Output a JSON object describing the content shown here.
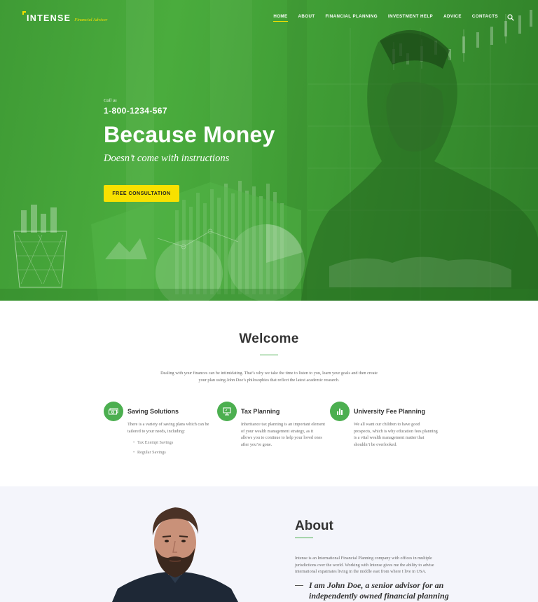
{
  "brand": {
    "name": "INTENSE",
    "tagline": "Financial Advisor",
    "accent": "#f5e000"
  },
  "nav": {
    "items": [
      "HOME",
      "ABOUT",
      "FINANCIAL PLANNING",
      "INVESTMENT HELP",
      "ADVICE",
      "CONTACTS"
    ],
    "active": "HOME",
    "search_icon": "search-icon"
  },
  "hero": {
    "call_label": "Call us",
    "phone": "1-800-1234-567",
    "title": "Because Money",
    "subtitle": "Doesn’t come with instructions",
    "cta": "FREE CONSULTATION",
    "overlay_color": "#43a33a",
    "cta_color": "#f8e100"
  },
  "welcome": {
    "title": "Welcome",
    "text": "Dealing with your finances can be intimidating. That’s why we take the time to listen to you, learn your goals and then create your plan using John Doe’s philosophies that reflect the latest academic research.",
    "features": [
      {
        "icon": "money-icon",
        "title": "Saving Solutions",
        "text": "There is a variety of saving plans which can be tailored to your needs, including:",
        "list": [
          "Tax Exempt Savings",
          "Regular Savings"
        ]
      },
      {
        "icon": "presentation-icon",
        "title": "Tax Planning",
        "text": "Inheritance tax planning is an important element of your wealth management strategy, as it allows you to continue to help your loved ones after you’re gone.",
        "list": []
      },
      {
        "icon": "bar-chart-icon",
        "title": "University Fee Planning",
        "text": "We all want our children to have good prospects, which is why education fees planning is a vital wealth management matter that shouldn’t be overlooked.",
        "list": []
      }
    ],
    "accent": "#4caf50"
  },
  "about": {
    "title": "About",
    "text": "Intense is an International Financial Planning company with offices in multiple jurisdictions over the world. Working with Intense gives me the ability to advise international expatriates living in the middle east from where I live in USA.",
    "quote": "I am John Doe, a senior advisor for an independently owned financial planning"
  }
}
